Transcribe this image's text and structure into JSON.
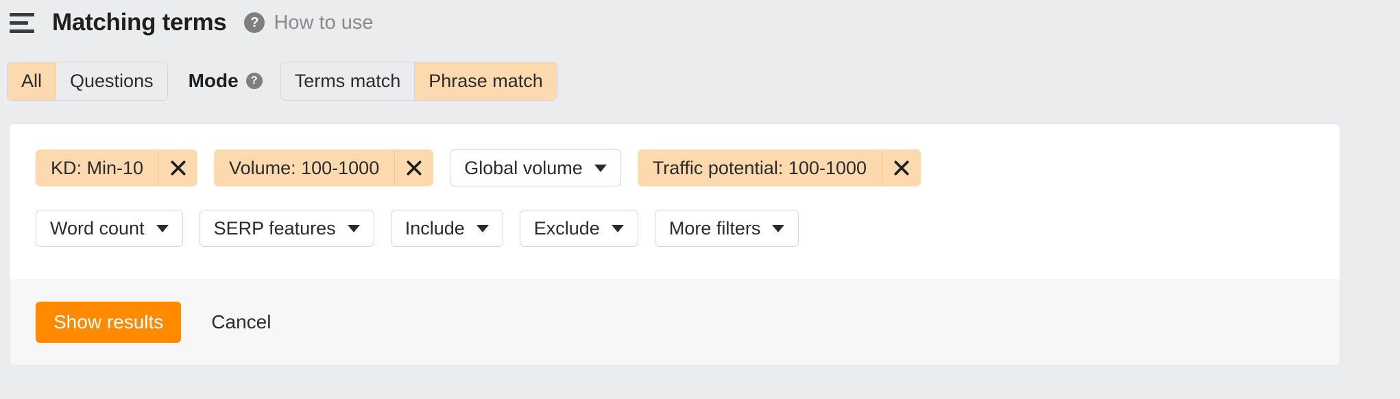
{
  "header": {
    "menu_icon": "hamburger-icon",
    "title": "Matching terms",
    "help_icon": "question-mark-icon",
    "how_to_use": "How to use"
  },
  "controls": {
    "scope_tabs": [
      {
        "label": "All",
        "active": true
      },
      {
        "label": "Questions",
        "active": false
      }
    ],
    "mode_label": "Mode",
    "mode_help_icon": "question-mark-icon",
    "mode_tabs": [
      {
        "label": "Terms match",
        "active": false
      },
      {
        "label": "Phrase match",
        "active": true
      }
    ]
  },
  "filters": {
    "active_chips": [
      {
        "label": "KD: Min-10",
        "remove_icon": "close-icon"
      },
      {
        "label": "Volume: 100-1000",
        "remove_icon": "close-icon"
      },
      {
        "label": "Traffic potential: 100-1000",
        "remove_icon": "close-icon"
      }
    ],
    "volume_scope": {
      "label": "Global volume",
      "caret_icon": "chevron-down-icon"
    },
    "dropdowns": [
      {
        "label": "Word count",
        "caret_icon": "chevron-down-icon"
      },
      {
        "label": "SERP features",
        "caret_icon": "chevron-down-icon"
      },
      {
        "label": "Include",
        "caret_icon": "chevron-down-icon"
      },
      {
        "label": "Exclude",
        "caret_icon": "chevron-down-icon"
      },
      {
        "label": "More filters",
        "caret_icon": "chevron-down-icon"
      }
    ]
  },
  "footer": {
    "submit_label": "Show results",
    "cancel_label": "Cancel"
  },
  "colors": {
    "accent_orange": "#ff8a00",
    "chip_peach": "#fcd9ae",
    "page_background": "#eaecee",
    "panel_background": "#ffffff",
    "footer_background": "#f7f7f8"
  }
}
